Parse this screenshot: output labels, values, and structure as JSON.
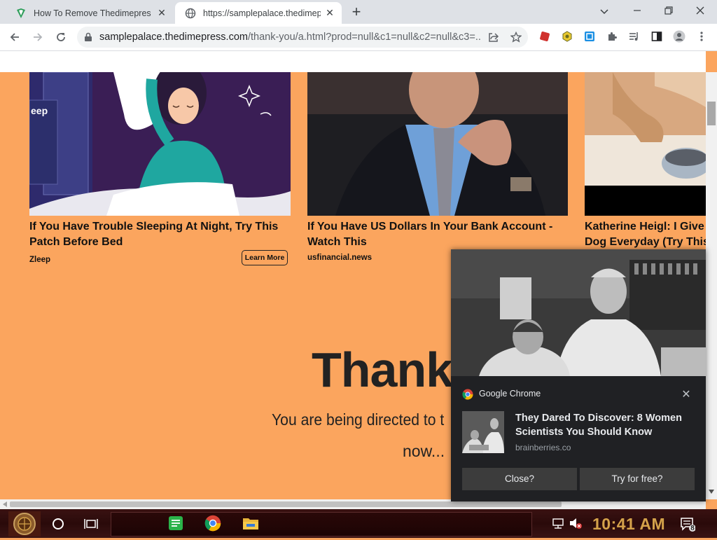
{
  "browser": {
    "tabs": [
      {
        "title": "How To Remove Thedimepress",
        "active": false
      },
      {
        "title": "https://samplepalace.thedimep",
        "active": true
      }
    ],
    "url_host": "samplepalace.thedimepress.com",
    "url_path": "/thank-you/a.html?prod=null&c1=null&c2=null&c3=..."
  },
  "ads": [
    {
      "title": "If You Have Trouble Sleeping At Night, Try This Patch Before Bed",
      "source": "Zleep",
      "button": "Learn More",
      "product_label": "eep"
    },
    {
      "title": "If You Have US Dollars In Your Bank Account - Watch This",
      "source": "usfinancial.news"
    },
    {
      "title": "Katherine Heigl: I Give Dog Everyday (Try This"
    }
  ],
  "page": {
    "heading": "Thank",
    "redirect_text": "You are being directed to t",
    "redirect_now": "now..."
  },
  "notification": {
    "app_name": "Google Chrome",
    "title": "They Dared To Discover: 8 Women Scientists You Should Know",
    "source": "brainberries.co",
    "buttons": [
      "Close?",
      "Try for free?"
    ]
  },
  "taskbar": {
    "time": "10:41 AM",
    "notification_count": "8"
  },
  "colors": {
    "page_background": "#fba55e",
    "notification_background": "#202124",
    "clock": "#d4a24a"
  }
}
